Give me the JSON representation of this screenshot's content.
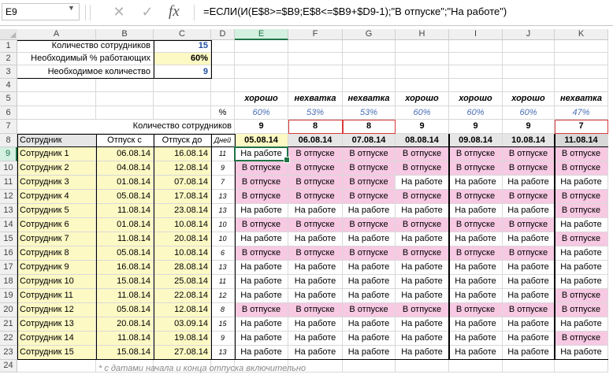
{
  "formula_bar": {
    "name_box": "E9",
    "cancel_icon": "✕",
    "enter_icon": "✓",
    "fx_label": "fx",
    "formula": "=ЕСЛИ(И(E$8>=$B9;E$8<=$B9+$D9-1);\"В отпуске\";\"На работе\")"
  },
  "columns": [
    "A",
    "B",
    "C",
    "D",
    "E",
    "F",
    "G",
    "H",
    "I",
    "J",
    "K"
  ],
  "rows": [
    "1",
    "2",
    "3",
    "4",
    "5",
    "6",
    "7",
    "8",
    "9",
    "10",
    "11",
    "12",
    "13",
    "14",
    "15",
    "16",
    "17",
    "18",
    "19",
    "20",
    "21",
    "22",
    "23",
    "24"
  ],
  "params": {
    "r1_label": "Количество сотрудников",
    "r1_value": "15",
    "r2_label": "Необходимый % работающих",
    "r2_value": "60%",
    "r3_label": "Необходимое количество",
    "r3_value": "9",
    "r6_label": "%",
    "r7_label": "Количество сотрудников"
  },
  "days": [
    {
      "status": "хорошо",
      "pct": "60%",
      "count": "9",
      "date": "05.08.14"
    },
    {
      "status": "нехватка",
      "pct": "53%",
      "count": "8",
      "date": "06.08.14"
    },
    {
      "status": "нехватка",
      "pct": "53%",
      "count": "8",
      "date": "07.08.14"
    },
    {
      "status": "хорошо",
      "pct": "60%",
      "count": "9",
      "date": "08.08.14"
    },
    {
      "status": "хорошо",
      "pct": "60%",
      "count": "9",
      "date": "09.08.14"
    },
    {
      "status": "хорошо",
      "pct": "60%",
      "count": "9",
      "date": "10.08.14"
    },
    {
      "status": "нехватка",
      "pct": "47%",
      "count": "7",
      "date": "11.08.14"
    }
  ],
  "headers": {
    "employee": "Сотрудник",
    "start": "Отпуск с",
    "end": "Отпуск до",
    "days": "Дней"
  },
  "employees": [
    {
      "name": "Сотрудник 1",
      "start": "06.08.14",
      "end": "16.08.14",
      "days": "11",
      "cells": [
        "На работе",
        "В отпуске",
        "В отпуске",
        "В отпуске",
        "В отпуске",
        "В отпуске",
        "В отпуске"
      ]
    },
    {
      "name": "Сотрудник 2",
      "start": "04.08.14",
      "end": "12.08.14",
      "days": "9",
      "cells": [
        "В отпуске",
        "В отпуске",
        "В отпуске",
        "В отпуске",
        "В отпуске",
        "В отпуске",
        "В отпуске"
      ]
    },
    {
      "name": "Сотрудник 3",
      "start": "01.08.14",
      "end": "07.08.14",
      "days": "7",
      "cells": [
        "В отпуске",
        "В отпуске",
        "В отпуске",
        "На работе",
        "На работе",
        "На работе",
        "На работе"
      ]
    },
    {
      "name": "Сотрудник 4",
      "start": "05.08.14",
      "end": "17.08.14",
      "days": "13",
      "cells": [
        "В отпуске",
        "В отпуске",
        "В отпуске",
        "В отпуске",
        "В отпуске",
        "В отпуске",
        "В отпуске"
      ]
    },
    {
      "name": "Сотрудник 5",
      "start": "11.08.14",
      "end": "23.08.14",
      "days": "13",
      "cells": [
        "На работе",
        "На работе",
        "На работе",
        "На работе",
        "На работе",
        "На работе",
        "В отпуске"
      ]
    },
    {
      "name": "Сотрудник 6",
      "start": "01.08.14",
      "end": "10.08.14",
      "days": "10",
      "cells": [
        "В отпуске",
        "В отпуске",
        "В отпуске",
        "В отпуске",
        "В отпуске",
        "В отпуске",
        "На работе"
      ]
    },
    {
      "name": "Сотрудник 7",
      "start": "11.08.14",
      "end": "20.08.14",
      "days": "10",
      "cells": [
        "На работе",
        "На работе",
        "На работе",
        "На работе",
        "На работе",
        "На работе",
        "В отпуске"
      ]
    },
    {
      "name": "Сотрудник 8",
      "start": "05.08.14",
      "end": "10.08.14",
      "days": "6",
      "cells": [
        "В отпуске",
        "В отпуске",
        "В отпуске",
        "В отпуске",
        "В отпуске",
        "В отпуске",
        "На работе"
      ]
    },
    {
      "name": "Сотрудник 9",
      "start": "16.08.14",
      "end": "28.08.14",
      "days": "13",
      "cells": [
        "На работе",
        "На работе",
        "На работе",
        "На работе",
        "На работе",
        "На работе",
        "На работе"
      ]
    },
    {
      "name": "Сотрудник 10",
      "start": "15.08.14",
      "end": "25.08.14",
      "days": "11",
      "cells": [
        "На работе",
        "На работе",
        "На работе",
        "На работе",
        "На работе",
        "На работе",
        "На работе"
      ]
    },
    {
      "name": "Сотрудник 11",
      "start": "11.08.14",
      "end": "22.08.14",
      "days": "12",
      "cells": [
        "На работе",
        "На работе",
        "На работе",
        "На работе",
        "На работе",
        "На работе",
        "В отпуске"
      ]
    },
    {
      "name": "Сотрудник 12",
      "start": "05.08.14",
      "end": "12.08.14",
      "days": "8",
      "cells": [
        "В отпуске",
        "В отпуске",
        "В отпуске",
        "В отпуске",
        "В отпуске",
        "В отпуске",
        "В отпуске"
      ]
    },
    {
      "name": "Сотрудник 13",
      "start": "20.08.14",
      "end": "03.09.14",
      "days": "15",
      "cells": [
        "На работе",
        "На работе",
        "На работе",
        "На работе",
        "На работе",
        "На работе",
        "На работе"
      ]
    },
    {
      "name": "Сотрудник 14",
      "start": "11.08.14",
      "end": "19.08.14",
      "days": "9",
      "cells": [
        "На работе",
        "На работе",
        "На работе",
        "На работе",
        "На работе",
        "На работе",
        "В отпуске"
      ]
    },
    {
      "name": "Сотрудник 15",
      "start": "15.08.14",
      "end": "27.08.14",
      "days": "13",
      "cells": [
        "На работе",
        "На работе",
        "На работе",
        "На работе",
        "На работе",
        "На работе",
        "На работе"
      ]
    }
  ],
  "footnote": "* с датами начала и конца отпуска включительно",
  "colors": {
    "vacation": "#f7c9e3",
    "input": "#fdf9c4",
    "selection": "#217346",
    "shortage": "#d83a3a"
  }
}
